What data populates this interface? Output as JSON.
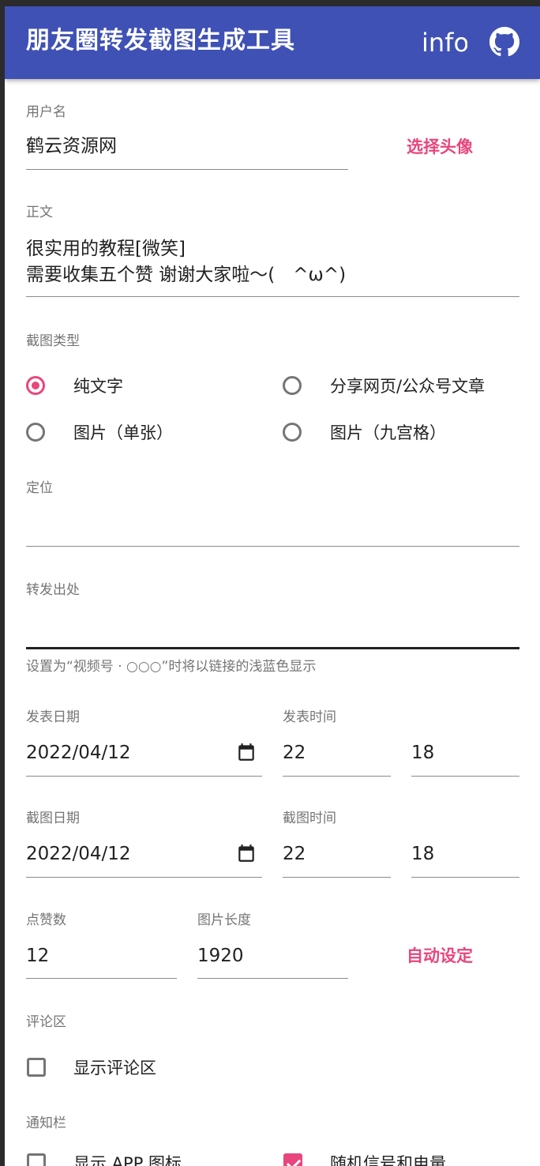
{
  "app": {
    "title": "朋友圈转发截图生成工具",
    "info_label": "info"
  },
  "username": {
    "label": "用户名",
    "value": "鹤云资源网",
    "action": "选择头像"
  },
  "body_text": {
    "label": "正文",
    "line1": "很实用的教程[微笑]",
    "line2": "需要收集五个赞 谢谢大家啦～(　^ω^)"
  },
  "screenshot_type": {
    "label": "截图类型",
    "options": [
      "纯文字",
      "分享网页/公众号文章",
      "图片（单张）",
      "图片（九宫格）"
    ],
    "selected": "纯文字"
  },
  "location": {
    "label": "定位",
    "value": ""
  },
  "repost_source": {
    "label": "转发出处",
    "value": "",
    "helper": "设置为“视频号 · ○○○”时将以链接的浅蓝色显示"
  },
  "publish": {
    "date_label": "发表日期",
    "date": "2022/04/12",
    "time_label": "发表时间",
    "hour": "22",
    "minute": "18"
  },
  "capture": {
    "date_label": "截图日期",
    "date": "2022/04/12",
    "time_label": "截图时间",
    "hour": "22",
    "minute": "18"
  },
  "likes": {
    "label": "点赞数",
    "value": "12"
  },
  "image_length": {
    "label": "图片长度",
    "value": "1920",
    "action": "自动设定"
  },
  "comments": {
    "label": "评论区",
    "checkbox": "显示评论区",
    "checked": false
  },
  "notification": {
    "label": "通知栏",
    "options": [
      {
        "label": "显示 APP 图标",
        "checked": false
      },
      {
        "label": "随机信号和电量",
        "checked": true
      }
    ]
  },
  "colors": {
    "primary": "#3f51b5",
    "accent": "#e8467c"
  },
  "icons": {
    "github": "github-icon",
    "calendar": "calendar-icon"
  }
}
